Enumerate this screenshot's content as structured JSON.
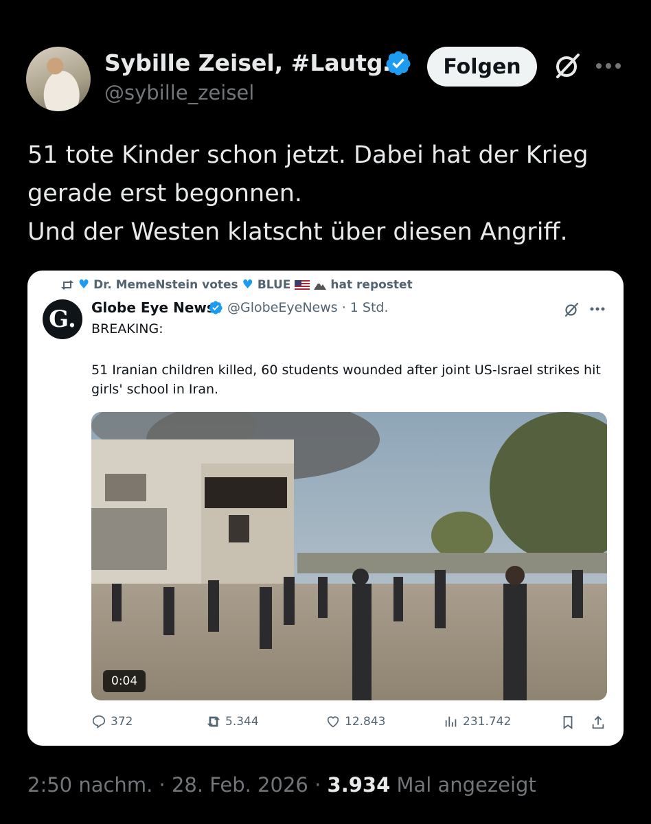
{
  "author": {
    "display_name": "Sybille Zeisel, #Lautg…",
    "handle": "@sybille_zeisel",
    "follow_label": "Folgen"
  },
  "tweet": {
    "lines": [
      "51 tote Kinder schon jetzt. Dabei hat der Krieg",
      "gerade erst begonnen.",
      "Und der Westen klatscht über diesen Angriff."
    ]
  },
  "embedded": {
    "repost_by": "Dr. MemeNstein votes",
    "repost_by_2": "BLUE",
    "repost_suffix": "hat repostet",
    "logo_letter": "G.",
    "name": "Globe Eye News",
    "handle_time": "@GlobeEyeNews · 1 Std.",
    "breaking": "BREAKING:",
    "body": "51 Iranian children killed, 60 students wounded after joint US-Israel strikes hit girls' school in Iran.",
    "video_time": "0:04",
    "metrics": {
      "replies": "372",
      "reposts": "5.344",
      "likes": "12.843",
      "views": "231.742"
    }
  },
  "footer": {
    "time_date": "2:50 nachm. · 28. Feb. 2026 · ",
    "views_count": "3.934",
    "views_label": " Mal angezeigt"
  },
  "colors": {
    "background": "#000000",
    "accent": "#1d9bf0",
    "secondary_text": "#71767b"
  }
}
